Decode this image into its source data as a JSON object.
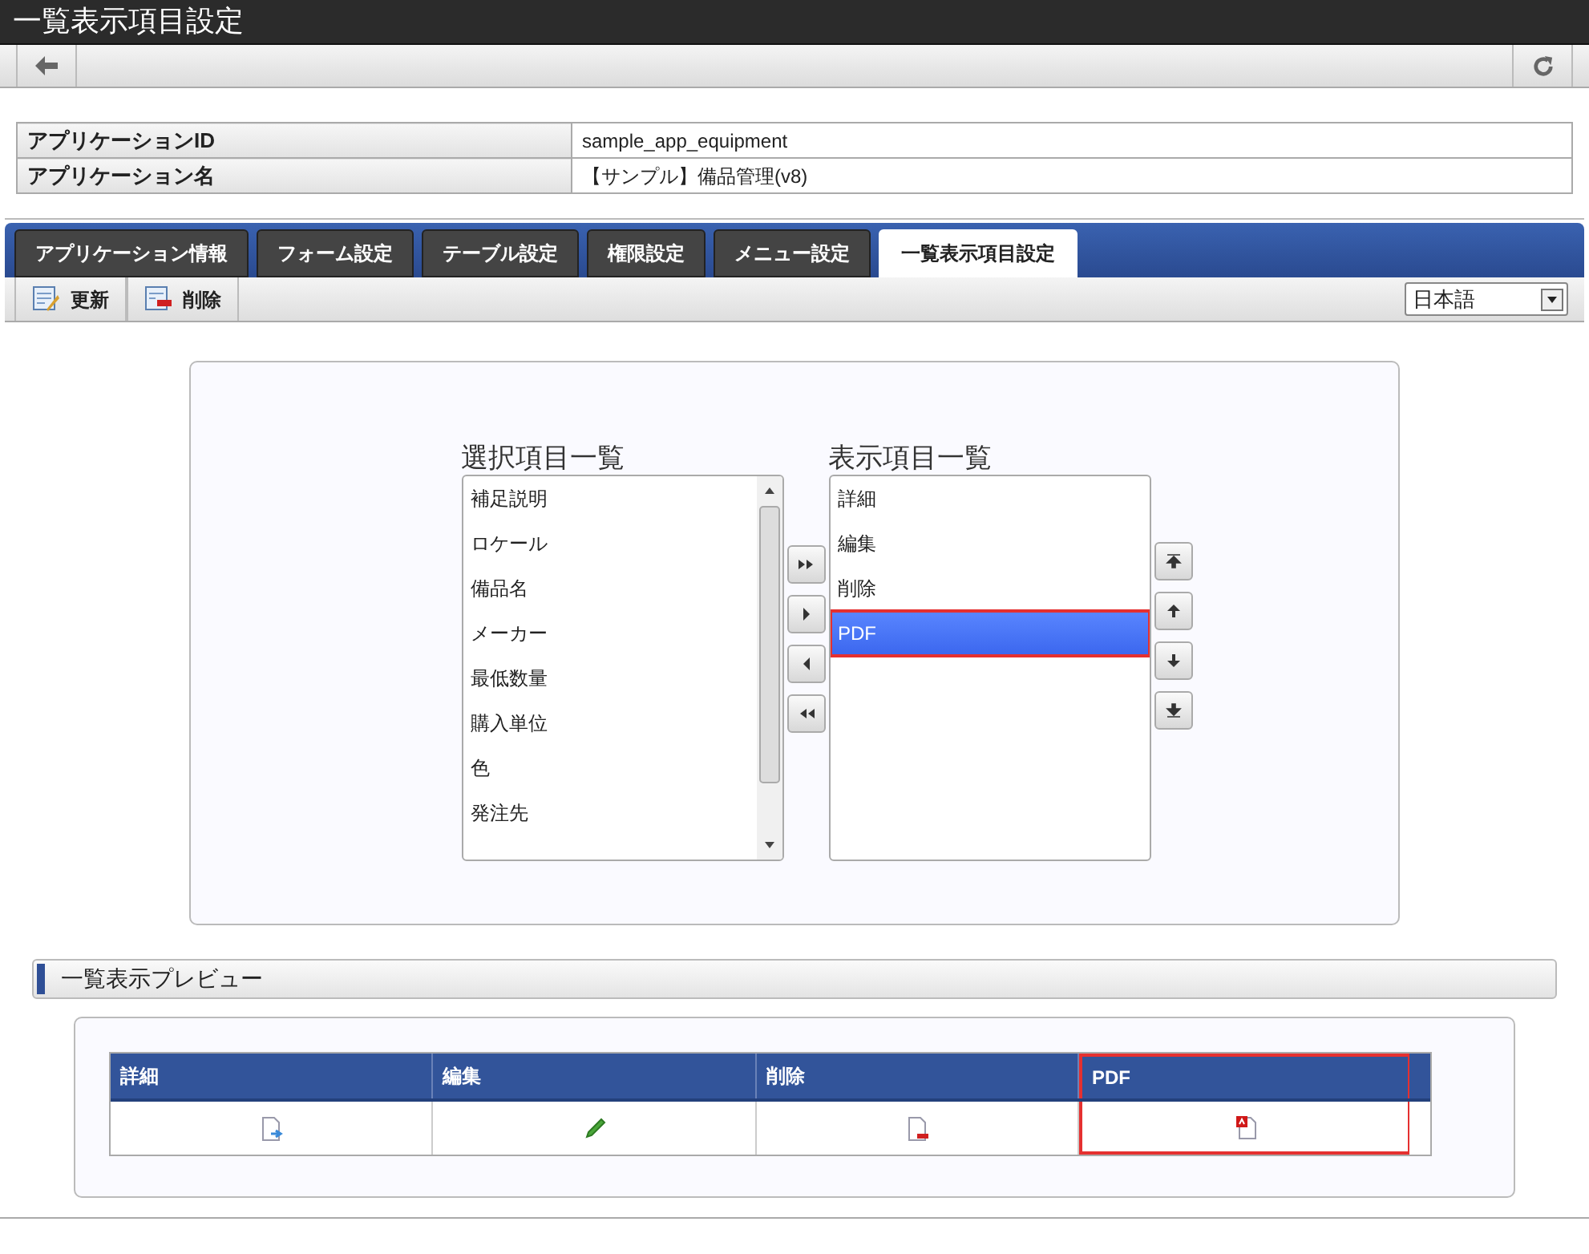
{
  "window": {
    "title": "一覧表示項目設定"
  },
  "app_info": [
    {
      "label": "アプリケーションID",
      "value": "sample_app_equipment"
    },
    {
      "label": "アプリケーション名",
      "value": "【サンプル】備品管理(v8)"
    }
  ],
  "tabs": [
    {
      "label": "アプリケーション情報",
      "selected": false
    },
    {
      "label": "フォーム設定",
      "selected": false
    },
    {
      "label": "テーブル設定",
      "selected": false
    },
    {
      "label": "権限設定",
      "selected": false
    },
    {
      "label": "メニュー設定",
      "selected": false
    },
    {
      "label": "一覧表示項目設定",
      "selected": true
    }
  ],
  "actions": [
    {
      "kind": "update",
      "label": "更新"
    },
    {
      "kind": "delete",
      "label": "削除"
    }
  ],
  "language": {
    "value": "日本語"
  },
  "available_items": {
    "title": "選択項目一覧",
    "items": [
      "補足説明",
      "ロケール",
      "備品名",
      "メーカー",
      "最低数量",
      "購入単位",
      "色",
      "発注先"
    ]
  },
  "displayed_items": {
    "title": "表示項目一覧",
    "items": [
      {
        "label": "詳細",
        "selected": false,
        "highlighted": false
      },
      {
        "label": "編集",
        "selected": false,
        "highlighted": false
      },
      {
        "label": "削除",
        "selected": false,
        "highlighted": false
      },
      {
        "label": "PDF",
        "selected": true,
        "highlighted": true
      }
    ]
  },
  "preview": {
    "title": "一覧表示プレビュー",
    "columns": [
      {
        "header": "詳細",
        "kind": "detail",
        "highlighted": false
      },
      {
        "header": "編集",
        "kind": "edit",
        "highlighted": false
      },
      {
        "header": "削除",
        "kind": "delete",
        "highlighted": false
      },
      {
        "header": "PDF",
        "kind": "pdf",
        "highlighted": true
      }
    ]
  }
}
